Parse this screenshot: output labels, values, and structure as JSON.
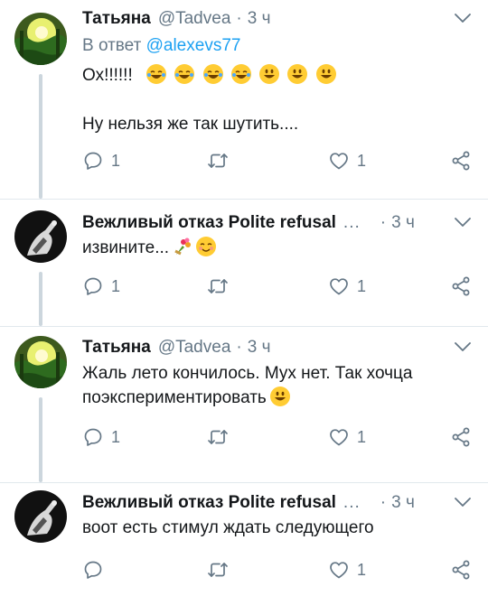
{
  "tweets": [
    {
      "name": "Татьяна",
      "handle": "@Tadvea",
      "sep": "·",
      "time": "3 ч",
      "reply_prefix": "В ответ",
      "reply_handle": "@alexevs77",
      "text_line1": "Ох!!!!!!",
      "text_line3": "Ну нельзя же так шутить....",
      "emoji_line1": [
        "joy-emoji",
        "joy-emoji",
        "joy-emoji",
        "joy-emoji",
        "smile-emoji",
        "smile-emoji",
        "smile-emoji"
      ],
      "replies": "1",
      "retweets": "",
      "likes": "1"
    },
    {
      "name": "Вежливый отказ Polite refusal",
      "ellipsis": "...",
      "sep": "·",
      "time": "3 ч",
      "text": "извините...",
      "emoji": [
        "bouquet-emoji",
        "blush-emoji"
      ],
      "replies": "1",
      "retweets": "",
      "likes": "1"
    },
    {
      "name": "Татьяна",
      "handle": "@Tadvea",
      "sep": "·",
      "time": "3 ч",
      "text_line1": "Жаль лето кончилось. Мух нет.  Так хочца",
      "text_line2": "поэкспериментировать",
      "emoji": [
        "smile-emoji"
      ],
      "replies": "1",
      "retweets": "",
      "likes": "1"
    },
    {
      "name": "Вежливый отказ Polite refusal",
      "ellipsis": "...",
      "sep": "·",
      "time": "3 ч",
      "text": "воот есть стимул ждать следующего",
      "replies": "",
      "retweets": "",
      "likes": "1"
    }
  ],
  "colors": {
    "link": "#1da1f2",
    "meta": "#657786",
    "thread": "#ccd6dd"
  }
}
